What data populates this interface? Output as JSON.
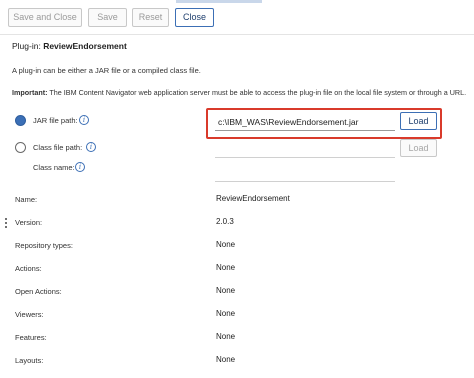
{
  "toolbar": {
    "save_close": "Save and Close",
    "save": "Save",
    "reset": "Reset",
    "close": "Close"
  },
  "plugin": {
    "header_label": "Plug-in: ",
    "header_name": "ReviewEndorsement",
    "description": "A plug-in can be either a JAR file or a compiled class file.",
    "important_label": "Important:",
    "important_text": " The IBM Content Navigator web application server must be able to access the plug-in file on the local file system or through a URL."
  },
  "source": {
    "jar_label": "JAR file path:",
    "jar_value": "c:\\IBM_WAS\\ReviewEndorsement.jar",
    "class_label": "Class file path:",
    "class_name_label": "Class name:",
    "load_label": "Load",
    "load_disabled_label": "Load"
  },
  "details": {
    "rows": [
      {
        "label": "Name:",
        "value": "ReviewEndorsement"
      },
      {
        "label": "Version:",
        "value": "2.0.3"
      },
      {
        "label": "Repository types:",
        "value": "None"
      },
      {
        "label": "Actions:",
        "value": "None"
      },
      {
        "label": "Open Actions:",
        "value": "None"
      },
      {
        "label": "Viewers:",
        "value": "None"
      },
      {
        "label": "Features:",
        "value": "None"
      },
      {
        "label": "Layouts:",
        "value": "None"
      }
    ]
  },
  "icons": {
    "info": "info-icon",
    "radio_selected": "radio-selected",
    "radio_unselected": "radio-unselected",
    "more": "kebab-menu-icon"
  }
}
